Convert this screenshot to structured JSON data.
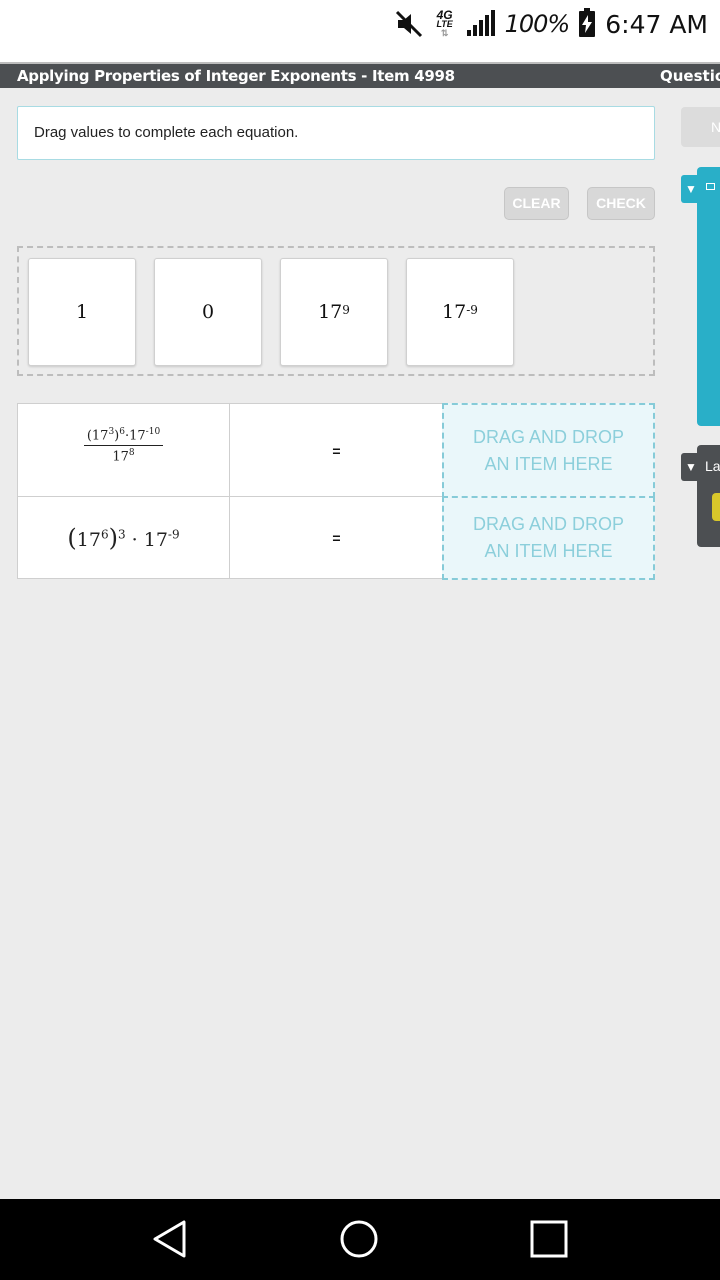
{
  "status_bar": {
    "mute_icon": "volume-muted-icon",
    "network": "4G",
    "network_sub": "LTE",
    "signal_icon": "signal-bars-icon",
    "battery_percent": "100%",
    "battery_icon": "battery-charging-icon",
    "time": "6:47 AM"
  },
  "header": {
    "title": "Applying Properties of Integer Exponents - Item 4998",
    "right_label": "Questio"
  },
  "instructions": "Drag values to complete each equation.",
  "next_button_partial": "N",
  "buttons": {
    "clear": "CLEAR",
    "check": "CHECK"
  },
  "tiles": [
    {
      "base": "1",
      "exponent": ""
    },
    {
      "base": "0",
      "exponent": ""
    },
    {
      "base": "17",
      "exponent": "9"
    },
    {
      "base": "17",
      "exponent": "-9"
    }
  ],
  "equations": [
    {
      "expression": {
        "numerator": {
          "inner_base": "17",
          "inner_exp": "3",
          "outer_exp": "6",
          "mult": "·",
          "factor_base": "17",
          "factor_exp": "-10"
        },
        "denominator": {
          "base": "17",
          "exp": "8"
        }
      },
      "equals": "=",
      "drop_line1": "DRAG AND DROP",
      "drop_line2": "AN ITEM HERE"
    },
    {
      "expression": {
        "inner_base": "17",
        "inner_exp": "6",
        "outer_exp": "3",
        "mult": "·",
        "factor_base": "17",
        "factor_exp": "-9"
      },
      "equals": "=",
      "drop_line1": "DRAG AND DROP",
      "drop_line2": "AN ITEM HERE"
    }
  ],
  "side_panels": {
    "dark_panel_label": "La"
  },
  "nav": {
    "back": "back-icon",
    "home": "home-icon",
    "recents": "recents-icon"
  },
  "colors": {
    "accent": "#29afc8",
    "header_bg": "#4c4f52",
    "drop_text": "#8ccfdb"
  }
}
